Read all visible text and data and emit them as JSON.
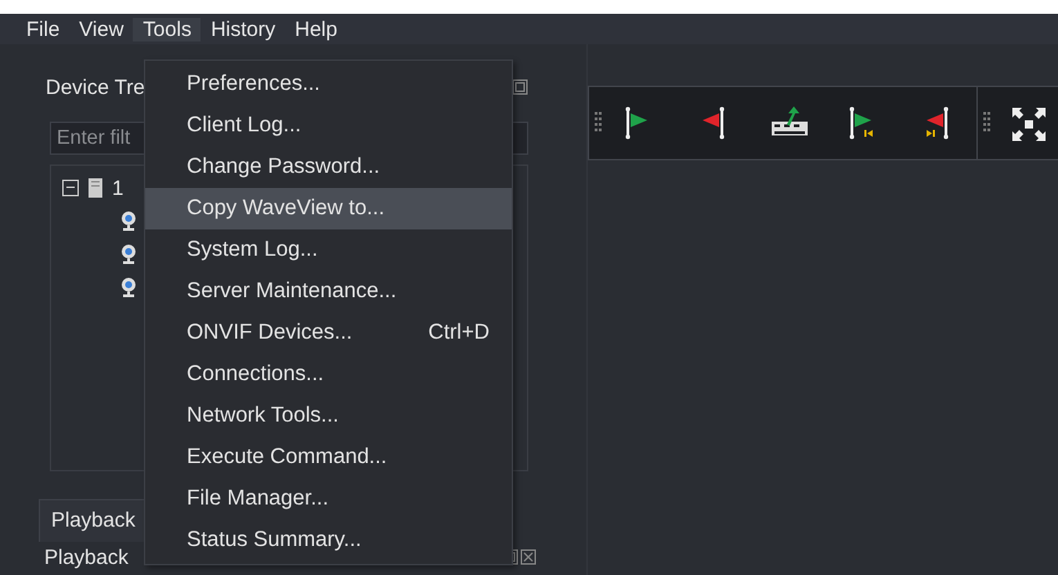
{
  "menu_bar": [
    {
      "label": "File",
      "selected": false
    },
    {
      "label": "View",
      "selected": false
    },
    {
      "label": "Tools",
      "selected": true
    },
    {
      "label": "History",
      "selected": false
    },
    {
      "label": "Help",
      "selected": false
    }
  ],
  "device_tree_panel": {
    "title": "Device Tre",
    "filter": {
      "placeholder": "Enter filt"
    },
    "tree": [
      {
        "label": "1",
        "expanded": true,
        "children": [
          {
            "kind": "camera"
          },
          {
            "kind": "camera"
          },
          {
            "kind": "camera"
          }
        ]
      }
    ]
  },
  "bottom_tab": {
    "label": "Playback",
    "selected": true
  },
  "playback_panel": {
    "title": "Playback"
  },
  "tools_menu": [
    {
      "label": "Preferences...",
      "selected": false
    },
    {
      "label": "Client Log...",
      "selected": false
    },
    {
      "label": "Change Password...",
      "selected": false
    },
    {
      "label": "Copy WaveView to...",
      "selected": true
    },
    {
      "label": "System Log...",
      "selected": false
    },
    {
      "label": "Server Maintenance...",
      "selected": false
    },
    {
      "label": "ONVIF Devices...",
      "shortcut": "Ctrl+D",
      "selected": false
    },
    {
      "label": "Connections...",
      "selected": false
    },
    {
      "label": "Network Tools...",
      "selected": false
    },
    {
      "label": "Execute Command...",
      "selected": false
    },
    {
      "label": "File Manager...",
      "selected": false
    },
    {
      "label": "Status Summary...",
      "selected": false
    }
  ],
  "toolbar": [
    {
      "kind": "start-flag"
    },
    {
      "kind": "end-flag"
    },
    {
      "kind": "export"
    },
    {
      "kind": "start-prev"
    },
    {
      "kind": "end-next"
    },
    {
      "kind": "grip"
    },
    {
      "kind": "fullscreen"
    }
  ]
}
